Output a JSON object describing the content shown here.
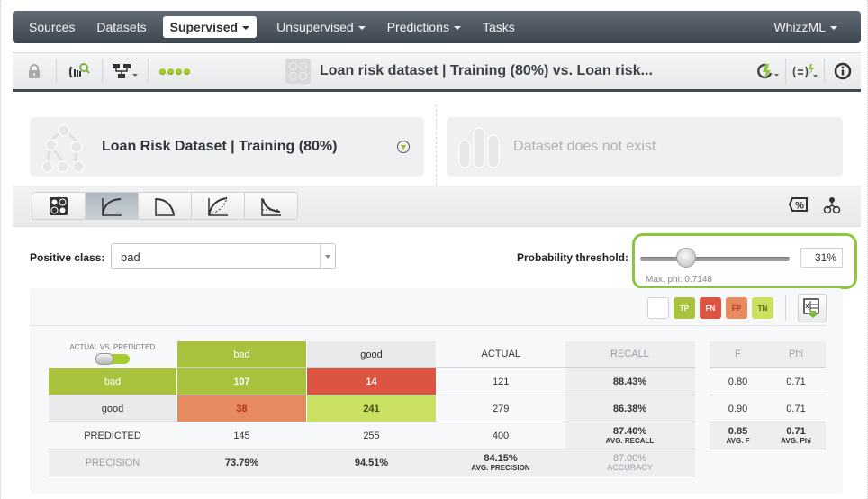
{
  "nav": {
    "items": [
      {
        "label": "Sources",
        "dropdown": false,
        "active": false
      },
      {
        "label": "Datasets",
        "dropdown": false,
        "active": false
      },
      {
        "label": "Supervised",
        "dropdown": true,
        "active": true
      },
      {
        "label": "Unsupervised",
        "dropdown": true,
        "active": false
      },
      {
        "label": "Predictions",
        "dropdown": true,
        "active": false
      },
      {
        "label": "Tasks",
        "dropdown": false,
        "active": false
      }
    ],
    "right": {
      "label": "WhizzML",
      "dropdown": true
    }
  },
  "toolbar": {
    "icons": [
      "lock-icon",
      "evaluation-search-icon",
      "model-tree-icon",
      "status-dots-icon"
    ],
    "title": "Loan risk dataset | Training (80%) vs. Loan risk...",
    "right_icons": [
      "reevaluate-lightning-icon",
      "formula-lightning-icon",
      "info-icon"
    ]
  },
  "datasets": {
    "left_title": "Loan Risk Dataset | Training (80%)",
    "right_title": "Dataset does not exist"
  },
  "views": {
    "buttons": [
      "confusion-matrix",
      "roc-curve",
      "precision-recall-curve",
      "gain-curve",
      "lift-curve"
    ],
    "active": 1,
    "right_icons": [
      "percent-tag-icon",
      "model-icon"
    ]
  },
  "controls": {
    "positive_class_label": "Positive class:",
    "positive_class_value": "bad",
    "threshold_label": "Probability threshold:",
    "threshold_value": "31%",
    "threshold_fraction": 0.31,
    "max_phi": "Max. phi: 0.7148"
  },
  "legend": {
    "items": [
      "TP",
      "FN",
      "FP",
      "TN"
    ],
    "colors": {
      "TP": "#a8c23e",
      "FN": "#dc5442",
      "FP": "#e68a60",
      "TN": "#c9e060"
    }
  },
  "matrix": {
    "corner_label": "ACTUAL VS. PREDICTED",
    "predicted_headers": [
      "bad",
      "good"
    ],
    "actual_header": "ACTUAL",
    "recall_header": "RECALL",
    "f_header": "F",
    "phi_header": "Phi",
    "rows": [
      {
        "label": "bad",
        "cells": [
          "107",
          "14"
        ],
        "actual": "121",
        "recall": "88.43%",
        "f": "0.80",
        "phi": "0.71"
      },
      {
        "label": "good",
        "cells": [
          "38",
          "241"
        ],
        "actual": "279",
        "recall": "86.38%",
        "f": "0.90",
        "phi": "0.71"
      }
    ],
    "predicted_row": {
      "label": "PREDICTED",
      "values": [
        "145",
        "255"
      ],
      "total": "400",
      "avg_recall": "87.40%",
      "avg_recall_label": "AVG. RECALL",
      "avg_f": "0.85",
      "avg_f_label": "AVG. F",
      "avg_phi": "0.71",
      "avg_phi_label": "AVG. Phi"
    },
    "precision_row": {
      "label": "PRECISION",
      "values": [
        "73.79%",
        "94.51%"
      ],
      "avg_precision": "84.15%",
      "avg_precision_label": "AVG. PRECISION",
      "accuracy": "87.00%",
      "accuracy_label": "ACCURACY"
    }
  }
}
